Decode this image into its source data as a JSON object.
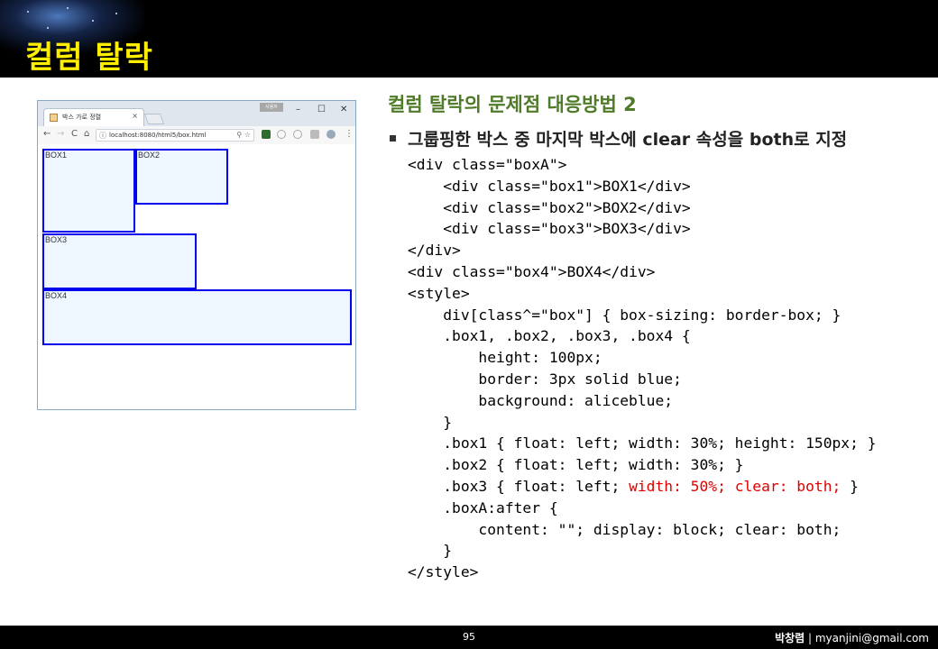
{
  "header": {
    "title": "컬럼 탈락"
  },
  "browser": {
    "tab_title": "박스 가로 정렬",
    "tab_close": "×",
    "user_badge": "사용자",
    "window_controls": {
      "minimize": "–",
      "maximize": "☐",
      "close": "✕"
    },
    "nav": {
      "back": "←",
      "forward": "→",
      "reload": "C",
      "home": "⌂"
    },
    "url": "localhost:8080/html5/box.html",
    "url_info": "ⓘ",
    "url_tools": "⚲ ☆",
    "menu": "⋮",
    "boxes": [
      "BOX1",
      "BOX2",
      "BOX3",
      "BOX4"
    ]
  },
  "content": {
    "subtitle": "컬럼 탈락의 문제점 대응방법 2",
    "bullet": "그룹핑한 박스 중 마지막 박스에 clear 속성을 both로 지정",
    "code_lines": [
      "<div class=\"boxA\">",
      "    <div class=\"box1\">BOX1</div>",
      "    <div class=\"box2\">BOX2</div>",
      "    <div class=\"box3\">BOX3</div>",
      "</div>",
      "<div class=\"box4\">BOX4</div>",
      "<style>",
      "    div[class^=\"box\"] { box-sizing: border-box; }",
      "    .box1, .box2, .box3, .box4 {",
      "        height: 100px;",
      "        border: 3px solid blue;",
      "        background: aliceblue;",
      "    }",
      "    .box1 { float: left; width: 30%; height: 150px; }",
      "    .box2 { float: left; width: 30%; }",
      "    .box3 { float: left; ",
      "    .boxA:after {",
      "        content: \"\"; display: block; clear: both;",
      "    }",
      "</style>"
    ],
    "code_highlight": "width: 50%; clear: both;",
    "code_after_highlight": " }"
  },
  "footer": {
    "page": "95",
    "author_name": "박창렴",
    "separator": " | ",
    "email": "myanjini@gmail.com"
  },
  "colors": {
    "title": "#ffee00",
    "subtitle": "#4f7a28",
    "highlight": "#e00000",
    "box_border": "#0000ee",
    "box_bg": "#eef6ff"
  }
}
